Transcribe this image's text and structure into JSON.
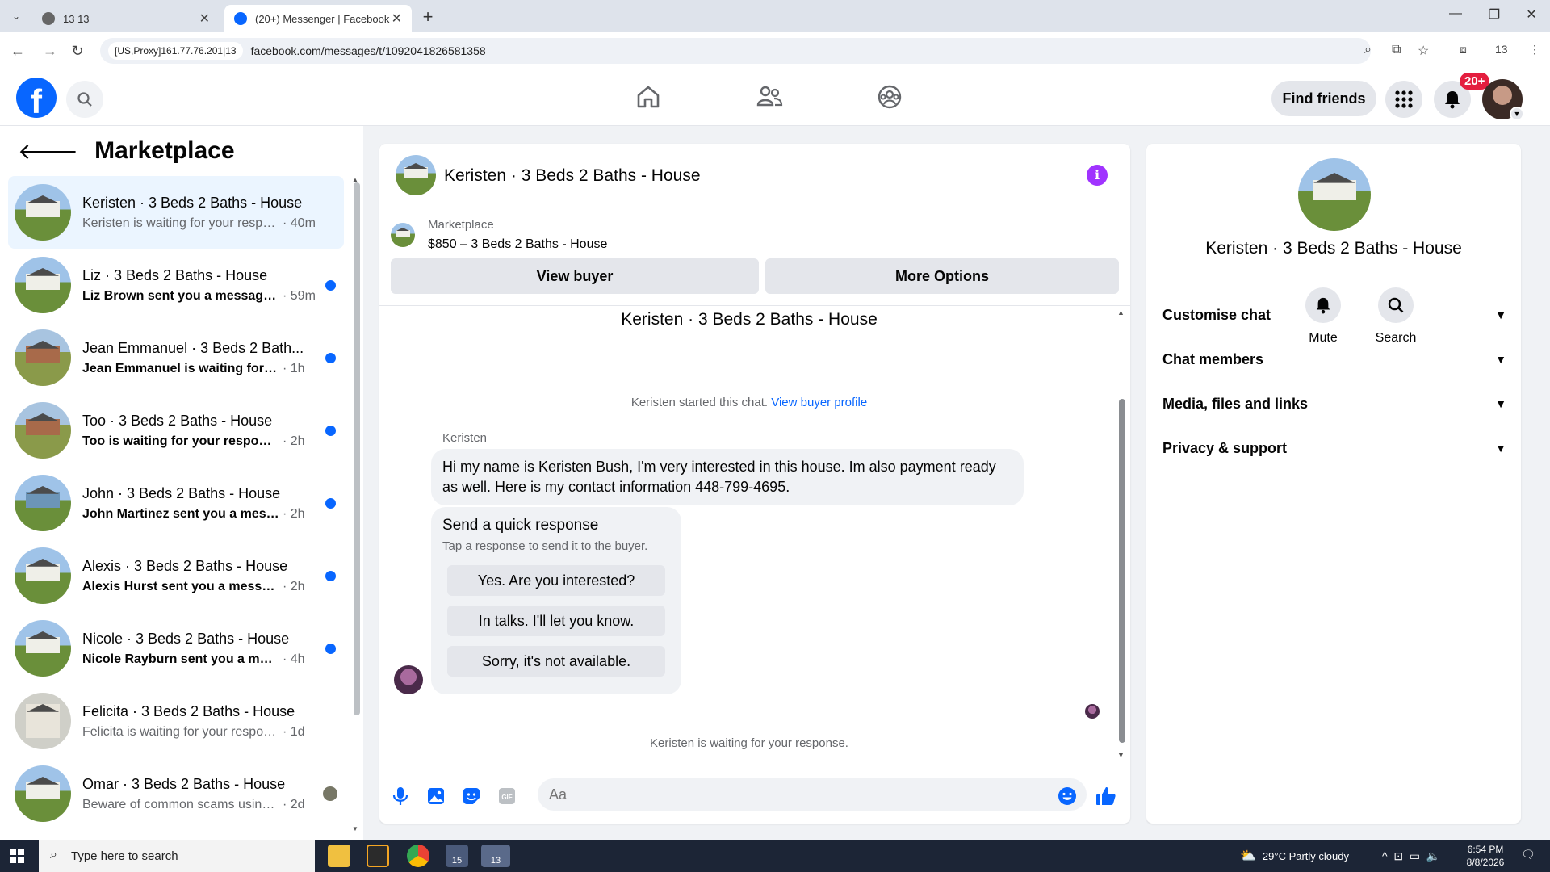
{
  "browser": {
    "tabs": [
      {
        "title": "13 13",
        "active": false
      },
      {
        "title": "(20+) Messenger | Facebook",
        "active": true
      }
    ],
    "proxy_label": "[US,Proxy]161.77.76.201|13",
    "url": "facebook.com/messages/t/1092041826581358",
    "profile_label": "13"
  },
  "fb_header": {
    "find_friends_label": "Find friends",
    "notification_badge": "20+"
  },
  "sidebar": {
    "title": "Marketplace",
    "conversations": [
      {
        "name": "Keristen · 3 Beds 2 Baths - House",
        "preview": "Keristen is waiting for your respo...",
        "time": "· 40m",
        "unread": false,
        "selected": true,
        "thumb": "house"
      },
      {
        "name": "Liz · 3 Beds 2 Baths - House",
        "preview": "Liz Brown sent you a message ...",
        "time": "· 59m",
        "unread": true,
        "selected": false,
        "thumb": "house"
      },
      {
        "name": "Jean Emmanuel · 3 Beds 2 Bath...",
        "preview": "Jean Emmanuel is waiting for yo...",
        "time": "· 1h",
        "unread": true,
        "selected": false,
        "thumb": "brick"
      },
      {
        "name": "Too · 3 Beds 2 Baths - House",
        "preview": "Too is waiting for your response.",
        "time": "· 2h",
        "unread": true,
        "selected": false,
        "thumb": "brick"
      },
      {
        "name": "John · 3 Beds 2 Baths - House",
        "preview": "John Martinez sent you a messa...",
        "time": "· 2h",
        "unread": true,
        "selected": false,
        "thumb": "blue"
      },
      {
        "name": "Alexis · 3 Beds 2 Baths - House",
        "preview": "Alexis Hurst sent you a message ...",
        "time": "· 2h",
        "unread": true,
        "selected": false,
        "thumb": "house"
      },
      {
        "name": "Nicole · 3 Beds 2 Baths - House",
        "preview": "Nicole Rayburn sent you a mess...",
        "time": "· 4h",
        "unread": true,
        "selected": false,
        "thumb": "house"
      },
      {
        "name": "Felicita · 3 Beds 2 Baths - House",
        "preview": "Felicita is waiting for your response.",
        "time": "· 1d",
        "unread": false,
        "selected": false,
        "thumb": "white"
      },
      {
        "name": "Omar · 3 Beds 2 Baths - House",
        "preview": "Beware of common scams using ...",
        "time": "· 2d",
        "unread": false,
        "selected": false,
        "thumb": "house"
      }
    ]
  },
  "chat": {
    "header_title": "Keristen · 3 Beds 2 Baths - House",
    "listing_source": "Marketplace",
    "listing_price": "$850 – 3 Beds 2 Baths - House",
    "view_buyer_label": "View buyer",
    "more_options_label": "More Options",
    "conversation_title": "Keristen · 3 Beds 2 Baths - House",
    "started_text": "Keristen started this chat.",
    "buyer_profile_link": "View buyer profile",
    "sender_name": "Keristen",
    "message": "Hi my name is Keristen Bush, I'm very interested in this house. Im also payment ready as well. Here is my contact information 448-799-4695.",
    "quick_title": "Send a quick response",
    "quick_subtitle": "Tap a response to send it to the buyer.",
    "quick_responses": [
      "Yes. Are you interested?",
      "In talks. I'll let you know.",
      "Sorry, it's not available."
    ],
    "waiting_text": "Keristen is waiting for your response.",
    "input_placeholder": "Aa"
  },
  "details": {
    "title": "Keristen · 3 Beds 2 Baths - House",
    "mute_label": "Mute",
    "search_label": "Search",
    "sections": [
      "Customise chat",
      "Chat members",
      "Media, files and links",
      "Privacy & support"
    ]
  },
  "taskbar": {
    "search_placeholder": "Type here to search",
    "weather": "29°C  Partly cloudy",
    "time": "6:54 PM",
    "date": "8/8/2026",
    "app_badges": [
      "15",
      "13"
    ]
  },
  "colors": {
    "fb_blue": "#0866ff",
    "unread_dot": "#0866ff",
    "info_purple": "#a033ff",
    "badge_red": "#e41e3f"
  }
}
